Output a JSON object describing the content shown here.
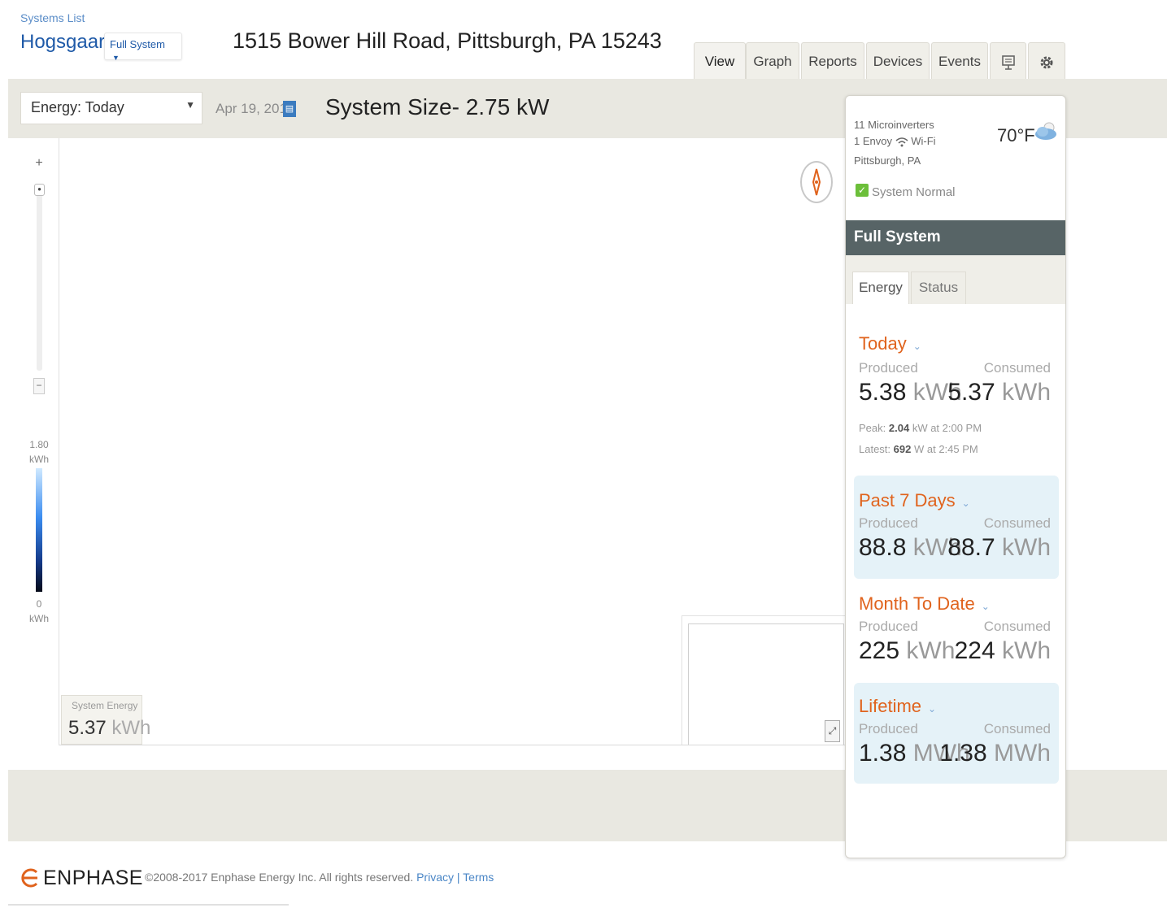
{
  "header": {
    "systems_list": "Systems List",
    "system_name": "Hogsgaard",
    "view_dropdown": "Full System",
    "address": "1515 Bower Hill Road, Pittsburgh, PA 15243"
  },
  "tabs": [
    {
      "label": "View",
      "active": true
    },
    {
      "label": "Graph",
      "active": false
    },
    {
      "label": "Reports",
      "active": false
    },
    {
      "label": "Devices",
      "active": false
    },
    {
      "label": "Events",
      "active": false
    }
  ],
  "icons": {
    "monitor_tab": "monitor-icon",
    "settings_tab": "gear-icon",
    "calendar": "calendar-icon",
    "compass": "compass-icon",
    "weather": "partly-cloudy-icon",
    "wifi": "wifi-icon",
    "expand": "expand-icon"
  },
  "toolbar": {
    "energy_select": "Energy: Today",
    "date": "Apr 19, 2017",
    "system_size": "System Size- 2.75 kW"
  },
  "map": {
    "zoom_plus": "+",
    "zoom_minus": "−",
    "legend_max_value": "1.80",
    "legend_max_unit": "kWh",
    "legend_min_value": "0",
    "legend_min_unit": "kWh",
    "system_energy_label": "System Energy",
    "system_energy_value": "5.37",
    "system_energy_unit": "kWh"
  },
  "side_panel": {
    "microinverters": "11 Microinverters",
    "envoy": "1 Envoy",
    "wifi_label": "Wi-Fi",
    "location": "Pittsburgh, PA",
    "temperature": "70°F",
    "status": "System Normal",
    "section_title": "Full System",
    "tabs": [
      {
        "label": "Energy",
        "active": true
      },
      {
        "label": "Status",
        "active": false
      }
    ],
    "stats": {
      "today": {
        "title": "Today",
        "produced_label": "Produced",
        "consumed_label": "Consumed",
        "produced_value": "5.38",
        "produced_unit": "kWh",
        "consumed_value": "5.37",
        "consumed_unit": "kWh",
        "peak_label": "Peak:",
        "peak_value": "2.04",
        "peak_rest": "kW at 2:00 PM",
        "latest_label": "Latest:",
        "latest_value": "692",
        "latest_rest": "W at 2:45 PM"
      },
      "past7": {
        "title": "Past 7 Days",
        "produced_label": "Produced",
        "consumed_label": "Consumed",
        "produced_value": "88.8",
        "produced_unit": "kWh",
        "consumed_value": "88.7",
        "consumed_unit": "kWh"
      },
      "month": {
        "title": "Month To Date",
        "produced_label": "Produced",
        "consumed_label": "Consumed",
        "produced_value": "225",
        "produced_unit": "kWh",
        "consumed_value": "224",
        "consumed_unit": "kWh"
      },
      "lifetime": {
        "title": "Lifetime",
        "produced_label": "Produced",
        "consumed_label": "Consumed",
        "produced_value": "1.38",
        "produced_unit": "MWh",
        "consumed_value": "1.38",
        "consumed_unit": "MWh"
      }
    }
  },
  "footer": {
    "brand": "ENPHASE",
    "copyright": "©2008-2017 Enphase Energy Inc. All rights reserved.",
    "privacy": "Privacy",
    "separator": "|",
    "terms": "Terms"
  },
  "colors": {
    "accent_orange": "#e0631d",
    "link_blue": "#1f5aa8",
    "panel_header": "#576466",
    "band": "#e9e8e1",
    "status_green": "#6cbf3a"
  }
}
